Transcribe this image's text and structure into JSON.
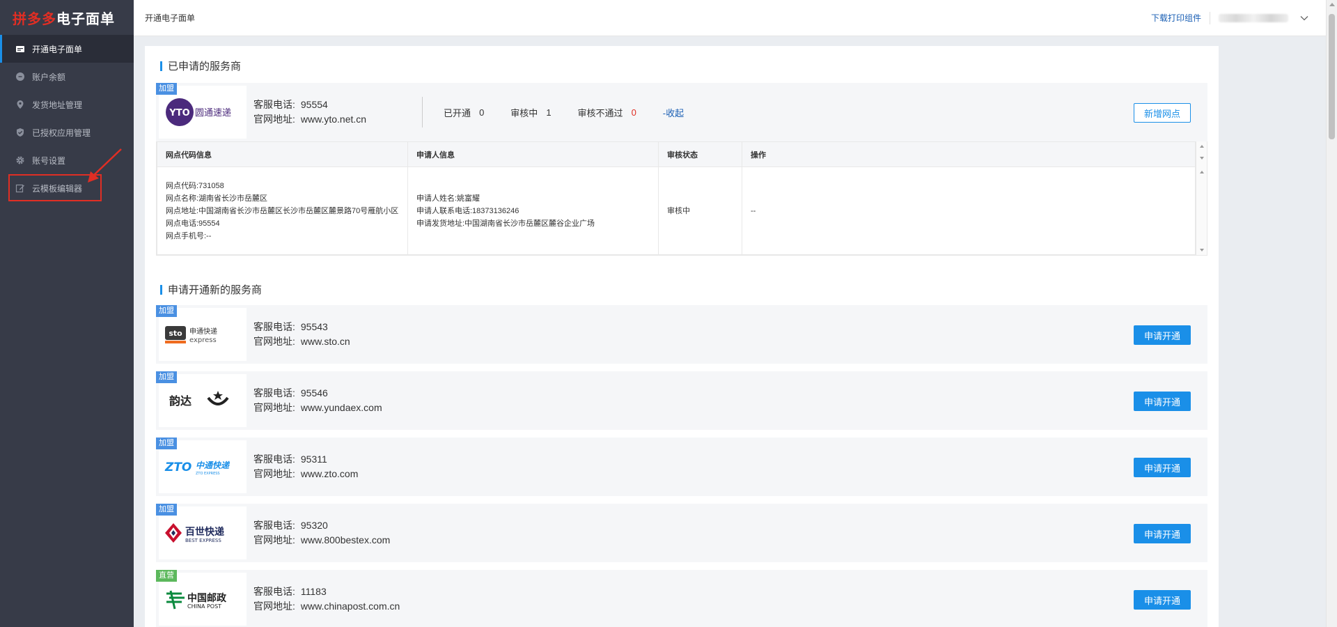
{
  "app": {
    "brand": "拼多多",
    "title": "电子面单"
  },
  "sidebar": {
    "items": [
      {
        "label": "开通电子面单",
        "icon": "card-icon"
      },
      {
        "label": "账户余额",
        "icon": "coin-icon"
      },
      {
        "label": "发货地址管理",
        "icon": "location-pin-icon"
      },
      {
        "label": "已授权应用管理",
        "icon": "shield-check-icon"
      },
      {
        "label": "账号设置",
        "icon": "gear-icon"
      },
      {
        "label": "云模板编辑器",
        "icon": "edit-icon"
      }
    ]
  },
  "header": {
    "breadcrumb": "开通电子面单",
    "download_link": "下载打印组件"
  },
  "applied": {
    "section_title": "已申请的服务商",
    "provider": {
      "tag": "加盟",
      "logo_text": "圆通速递",
      "logo_mark": "YTO",
      "phone_label": "客服电话:",
      "phone": "95554",
      "site_label": "官网地址:",
      "site": "www.yto.net.cn"
    },
    "stats": {
      "opened_label": "已开通",
      "opened": "0",
      "reviewing_label": "审核中",
      "reviewing": "1",
      "rejected_label": "审核不通过",
      "rejected": "0",
      "collapse": "-收起"
    },
    "add_button": "新增网点",
    "table": {
      "headers": [
        "网点代码信息",
        "申请人信息",
        "审核状态",
        "操作"
      ],
      "row": {
        "outlet_lines": [
          "网点代码:731058",
          "网点名称:湖南省长沙市岳麓区",
          "网点地址:中国湖南省长沙市岳麓区长沙市岳麓区麓景路70号雁航小区",
          "网点电话:95554",
          "网点手机号:--"
        ],
        "applicant_lines": [
          "申请人姓名:姚富耀",
          "申请人联系电话:18373136246",
          "申请发货地址:中国湖南省长沙市岳麓区麓谷企业广场"
        ],
        "status": "审核中",
        "action": "--"
      }
    }
  },
  "new_providers": {
    "section_title": "申请开通新的服务商",
    "phone_label": "客服电话:",
    "site_label": "官网地址:",
    "apply_button": "申请开通",
    "items": [
      {
        "tag": "加盟",
        "logo_text": "申通快递",
        "logo_sub": "express",
        "logo_mark": "sto",
        "phone": "95543",
        "site": "www.sto.cn"
      },
      {
        "tag": "加盟",
        "logo_text": "韵达",
        "logo_mark": "韵达",
        "phone": "95546",
        "site": "www.yundaex.com"
      },
      {
        "tag": "加盟",
        "logo_text": "中通快递",
        "logo_sub": "ZTO EXPRESS",
        "logo_mark": "ZTO",
        "phone": "95311",
        "site": "www.zto.com"
      },
      {
        "tag": "加盟",
        "logo_text": "百世快递",
        "logo_sub": "BEST EXPRESS",
        "phone": "95320",
        "site": "www.800bestex.com"
      },
      {
        "tag": "直营",
        "logo_text": "中国邮政",
        "logo_sub": "CHINA POST",
        "phone": "11183",
        "site": "www.chinapost.com.cn"
      }
    ]
  },
  "colors": {
    "sidebar_bg": "#373b48",
    "accent": "#1a8fe8",
    "brand_red": "#e02e24",
    "link": "#1a5fb4"
  }
}
